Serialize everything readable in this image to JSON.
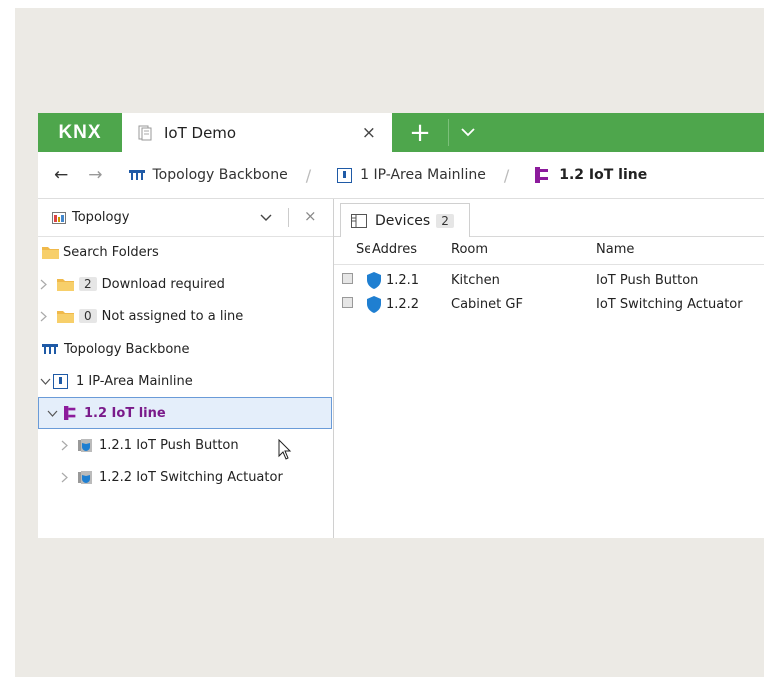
{
  "app": {
    "logo": "KNX",
    "tab_title": "IoT Demo",
    "tab_close": "×",
    "new_tab": "+",
    "tab_menu": "chevron-down-icon"
  },
  "breadcrumb": {
    "back": "←",
    "forward": "→",
    "items": [
      {
        "label": "Topology Backbone",
        "icon": "topology-icon"
      },
      {
        "label": "1 IP-Area Mainline",
        "icon": "area-icon"
      },
      {
        "label": "1.2 IoT line",
        "icon": "line-icon"
      }
    ],
    "separator": "/"
  },
  "left_panel": {
    "view_select": "Topology",
    "close": "×",
    "tree": [
      {
        "label": "Search Folders"
      },
      {
        "badge": "2",
        "label": "Download required"
      },
      {
        "badge": "0",
        "label": "Not assigned to a line"
      },
      {
        "label": "Topology Backbone"
      },
      {
        "label": "1 IP-Area Mainline"
      },
      {
        "label": "1.2 IoT line"
      },
      {
        "label": "1.2.1 IoT Push Button"
      },
      {
        "label": "1.2.2 IoT Switching Actuator"
      }
    ]
  },
  "devices_panel": {
    "tab_label": "Devices",
    "tab_count": "2",
    "columns": [
      "Se",
      "Addres",
      "Room",
      "Name"
    ],
    "rows": [
      {
        "address": "1.2.1",
        "room": "Kitchen",
        "name": "IoT Push Button"
      },
      {
        "address": "1.2.2",
        "room": "Cabinet GF",
        "name": "IoT Switching Actuator"
      }
    ]
  },
  "colors": {
    "titlebar": "#4ea64c",
    "line_purple": "#8c1b9c",
    "area_blue": "#1f5aa6",
    "selection_bg": "#e4eefa"
  }
}
